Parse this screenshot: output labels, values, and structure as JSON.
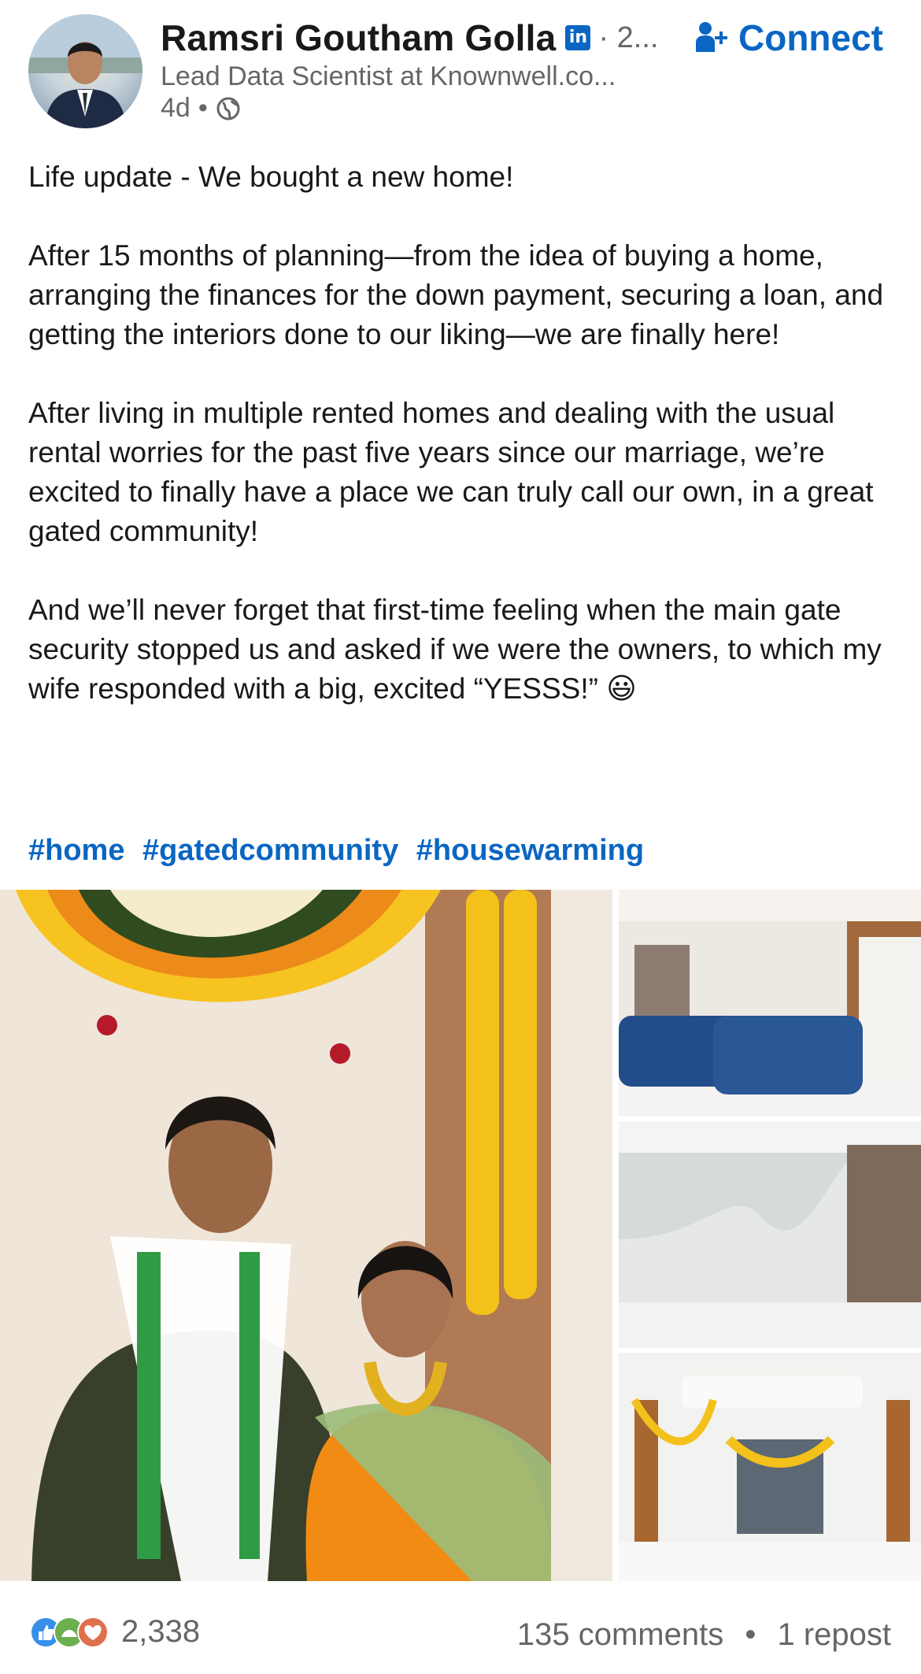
{
  "author": {
    "name": "Ramsri Goutham Golla",
    "badge_icon": "linkedin-badge-icon",
    "badge_text": "in",
    "degree": "· 2...",
    "headline": "Lead Data Scientist at Knownwell.co...",
    "time": "4d",
    "visibility_icon": "globe-icon"
  },
  "actions": {
    "connect_label": "Connect"
  },
  "post": {
    "paragraphs": [
      "Life update - We bought a new home!",
      "After 15 months of planning—from the idea of buying a home, arranging the finances for the down payment, securing a loan, and getting the interiors done to our liking—we are finally here!",
      "After living in multiple rented homes and dealing with the usual rental worries for the past five years since our marriage, we’re excited to finally have a place we can truly call our own, in a great gated community!",
      "And we’ll never forget that first-time feeling when the main gate security stopped us and asked if we were the owners, to which my wife responded with a big, excited “YESSS!” 😃"
    ],
    "hashtags": [
      "#home",
      "#gatedcommunity",
      "#housewarming"
    ]
  },
  "social": {
    "reaction_icons": [
      "like-icon",
      "support-icon",
      "love-icon"
    ],
    "reaction_count": "2,338",
    "comments": "135 comments",
    "separator": "•",
    "reposts": "1 repost"
  },
  "colors": {
    "brand": "#0a66c2",
    "text": "#191919",
    "muted": "#666666"
  }
}
